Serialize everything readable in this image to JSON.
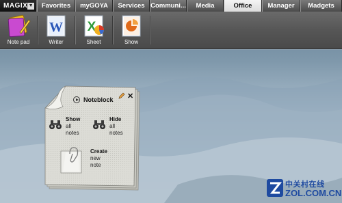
{
  "menu": {
    "brand": "MAGIX",
    "tabs": [
      {
        "label": "Favorites"
      },
      {
        "label": "myGOYA"
      },
      {
        "label": "Services"
      },
      {
        "label": "Communi..."
      },
      {
        "label": "Media"
      },
      {
        "label": "Office",
        "active": true
      },
      {
        "label": "Manager"
      },
      {
        "label": "Madgets"
      }
    ]
  },
  "toolbar": {
    "items": [
      {
        "label": "Note pad",
        "icon": "note-pad-icon"
      },
      {
        "label": "Writer",
        "icon": "writer-icon"
      },
      {
        "label": "Sheet",
        "icon": "sheet-icon"
      },
      {
        "label": "Show",
        "icon": "show-icon"
      }
    ]
  },
  "notewidget": {
    "title": "Noteblock",
    "show": {
      "title": "Show",
      "line1": "all",
      "line2": "notes"
    },
    "hide": {
      "title": "Hide",
      "line1": "all",
      "line2": "notes"
    },
    "create": {
      "title": "Create",
      "line1": "new",
      "line2": "note"
    }
  },
  "watermark": {
    "cn": "中关村在线",
    "en": "ZOL.COM.CN"
  },
  "colors": {
    "accent_word": "#2b57b8",
    "accent_sheet": "#2e9a3a",
    "accent_show": "#e06a1a",
    "watermark": "#1e4aa0"
  }
}
